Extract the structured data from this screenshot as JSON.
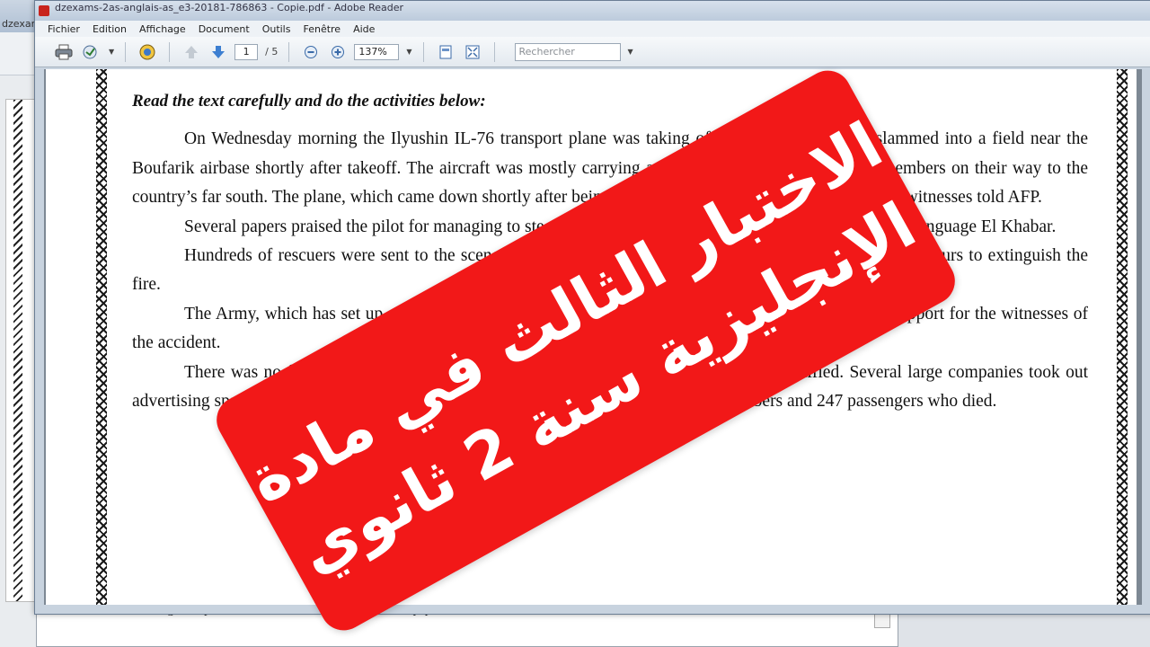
{
  "window": {
    "title": "dzexams-2as-anglais-as_e3-20181-786863 - Copie.pdf - Adobe Reader",
    "bg_title": "dzexams-"
  },
  "menu": [
    "Fichier",
    "Edition",
    "Affichage",
    "Document",
    "Outils",
    "Fenêtre",
    "Aide"
  ],
  "toolbar": {
    "page_current": "1",
    "page_total": "/ 5",
    "zoom": "137%",
    "search_placeholder": "Rechercher"
  },
  "icons": {
    "print": "printer-icon",
    "email": "email-icon",
    "collaborate": "collaborate-icon",
    "prev_page": "arrow-up-icon",
    "next_page": "arrow-down-icon",
    "zoom_out": "zoom-out-icon",
    "zoom_in": "zoom-in-icon",
    "fit_width": "fit-width-icon",
    "fit_page": "fit-page-icon"
  },
  "document": {
    "heading": "Read the text carefully and do the activities below:",
    "paragraphs": [
      "On Wednesday morning  the Ilyushin IL-76 transport plane was taking off in southwest Algeria  slammed into a field near the Boufarik airbase shortly after takeoff. The aircraft was mostly carrying army personnal and their family members on their way to the country’s far south. The plane, which came down shortly after being hit by something, crashed on the ground, witnesses told AFP.",
      "Several papers praised the pilot for managing to steer the plane away from nearby homes, wrote Arabic-language El Khabar.",
      "Hundreds of rescuers were sent to the scene of the crash, in an uninhabited area. Firefighters took two hours to extinguish the fire.",
      "The Army, which has set up a center where the bodies were transported, has set up a psychological support for the witnesses of the accident.",
      "There was no funeral arrangements, as many of the victims’ bodies had yet to be identified.   Several large companies took out advertising space in newspapers to offer condolences to the families of the 10 crew members and 247 passengers who died."
    ],
    "bottom_snippet": "be identified.   Several large companies took out advertising space in newspapers to offer condolences to the"
  },
  "banner": {
    "line1": "الاختبار الثالث في مادة",
    "line2": "الإنجليزية سنة 2 ثانوي",
    "color": "#f21818"
  }
}
